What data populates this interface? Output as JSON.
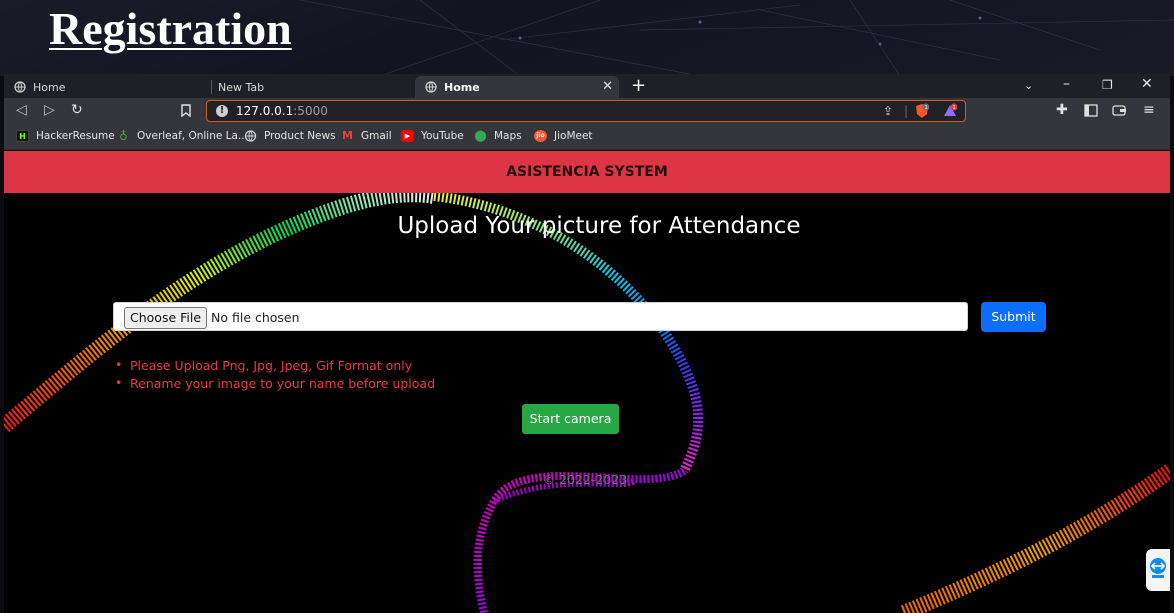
{
  "slide": {
    "title": "Registration"
  },
  "browser": {
    "tabs": [
      {
        "label": "Home",
        "active": false
      },
      {
        "label": "New Tab",
        "active": false
      },
      {
        "label": "Home",
        "active": true
      }
    ],
    "url_host": "127.0.0.1",
    "url_port": ":5000",
    "brave_shield_count": "1",
    "rewards_count": "1",
    "bookmarks": [
      {
        "label": "HackerResume",
        "icon": "hackerresume-icon",
        "color": "#111111"
      },
      {
        "label": "Overleaf, Online La...",
        "icon": "overleaf-icon",
        "color": "#47a141"
      },
      {
        "label": "Product News",
        "icon": "globe-icon",
        "color": "#888888"
      },
      {
        "label": "Gmail",
        "icon": "gmail-icon",
        "color": "#ea4335"
      },
      {
        "label": "YouTube",
        "icon": "youtube-icon",
        "color": "#ff0000"
      },
      {
        "label": "Maps",
        "icon": "maps-icon",
        "color": "#34a853"
      },
      {
        "label": "JioMeet",
        "icon": "jiomeet-icon",
        "color": "#e85a3a"
      }
    ]
  },
  "page": {
    "navbar_title": "ASISTENCIA SYSTEM",
    "heading": "Upload Your picture for Attendance",
    "choose_file_label": "Choose File",
    "no_file_text": "No file chosen",
    "submit_label": "Submit",
    "notes": [
      "Please Upload Png, Jpg, Jpeg, Gif Format only",
      "Rename your image to your name before upload"
    ],
    "camera_label": "Start camera",
    "footer": "© 2022-2023"
  },
  "colors": {
    "navbar": "#dc3545",
    "submit": "#0d6efd",
    "camera": "#28a745",
    "notes": "#e83a48",
    "omnibox_border": "#d35a1e"
  }
}
